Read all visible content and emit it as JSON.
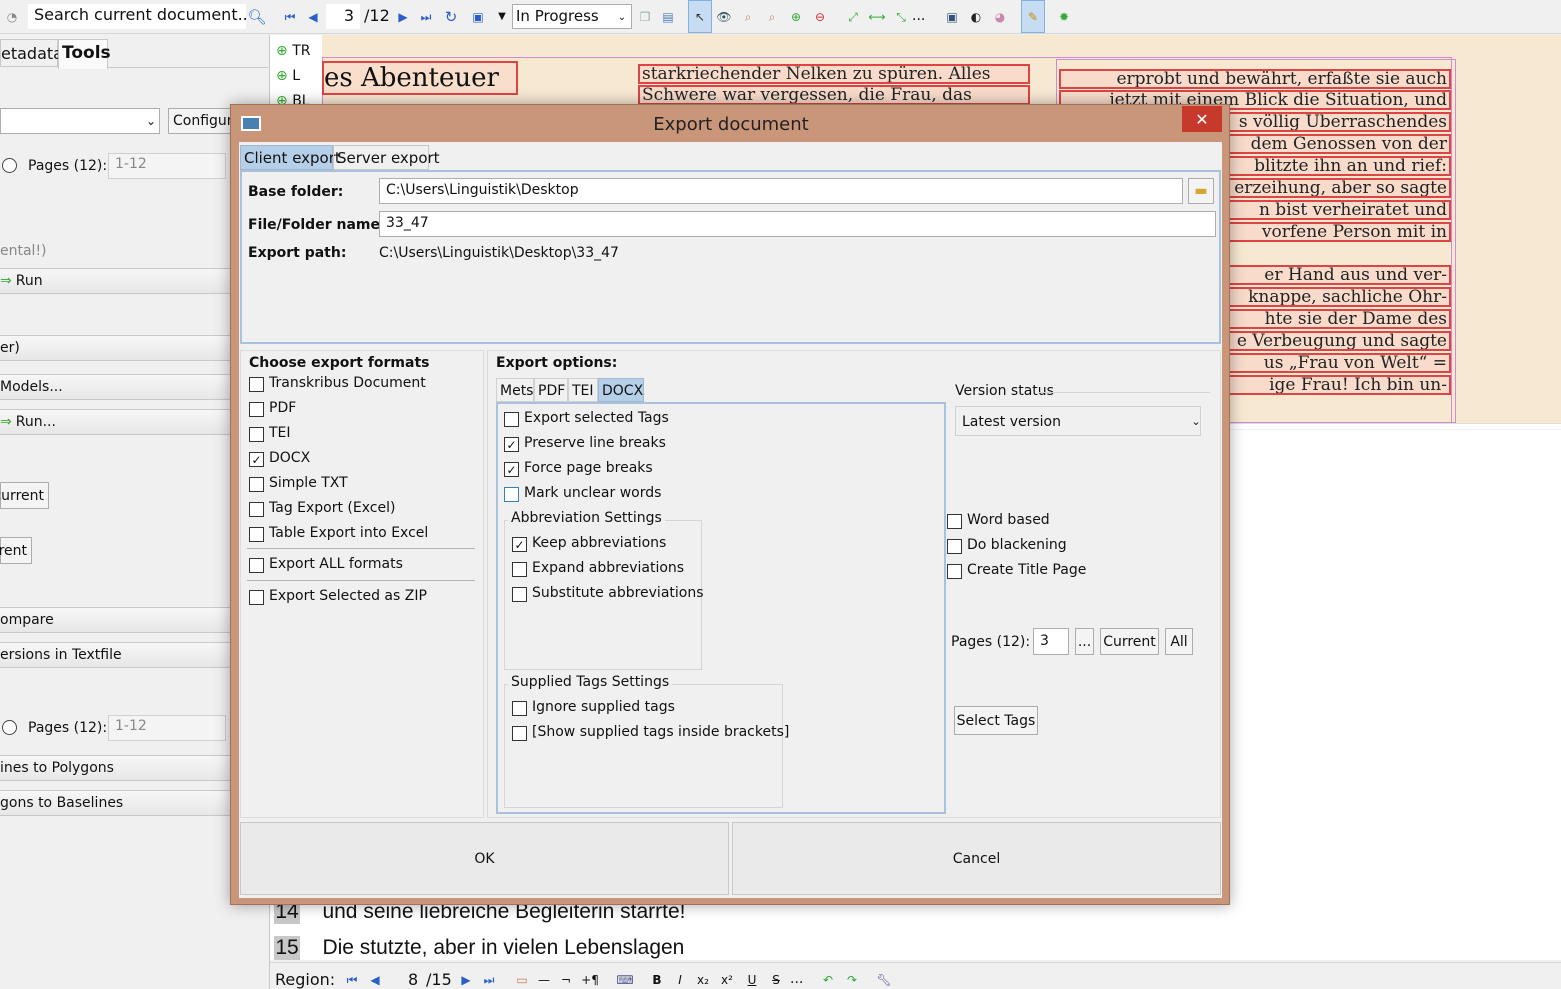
{
  "toolbar": {
    "search_placeholder": "Search current document...",
    "page_current": "3",
    "page_total": "/12",
    "status_value": "In Progress",
    "more": "..."
  },
  "left_panel": {
    "tab_metadata": "etadata",
    "tab_tools": "Tools",
    "configure_label": "Configur",
    "pages_label": "Pages (12):",
    "pages_value": "1-12",
    "experimental": "ental!)",
    "run": "Run",
    "er_label": "er)",
    "models": "Models...",
    "run2": "Run...",
    "current": "current",
    "rent": "rent",
    "compare": "ompare",
    "versions_textfile": "ersions in Textfile",
    "pages_label2": "Pages (12):",
    "pages_value2": "1-12",
    "lines_to_polygons": "ines to Polygons",
    "polygons_to_baselines": "gons to Baselines"
  },
  "layer_list": [
    "TR",
    "L",
    "BL"
  ],
  "doc_image": {
    "heading": "es Abenteuer",
    "col2": [
      "starkriechender Nelken zu spüren. Alles",
      "Schwere war vergessen, die Frau, das"
    ],
    "col3": [
      "erprobt und bewährt, erfaßte sie auch",
      "jetzt mit einem Blick die Situation, und",
      "s völlig Überraschendes",
      "dem Genossen von der",
      "blitzte ihn an und rief:",
      "erzeihung, aber so sagte",
      "n bist verheiratet und",
      "vorfene Person mit in",
      "er Hand aus und ver-",
      "knappe, sachliche Ohr-",
      "hte sie der Dame des",
      "e Verbeugung und sagte",
      "us „Frau von Welt“ =",
      "ige Frau! Ich bin un-"
    ]
  },
  "text_lines": [
    {
      "num": "14",
      "text": "und seine liebreiche Begleiterin starrte!"
    },
    {
      "num": "15",
      "text": "Die stutzte, aber in vielen Lebenslagen"
    }
  ],
  "bottom_bar": {
    "region_label": "Region:",
    "page_current": "8",
    "page_total": "/15",
    "more": "..."
  },
  "dialog": {
    "title": "Export document",
    "close": "✕",
    "tabs": [
      "Client export",
      "Server export"
    ],
    "base_folder_label": "Base folder:",
    "base_folder_value": "C:\\Users\\Linguistik\\Desktop",
    "file_name_label": "File/Folder name:",
    "file_name_value": "33_47",
    "export_path_label": "Export path:",
    "export_path_value": "C:\\Users\\Linguistik\\Desktop\\33_47",
    "formats_title": "Choose export formats",
    "formats": [
      {
        "label": "Transkribus Document",
        "checked": false
      },
      {
        "label": "PDF",
        "checked": false
      },
      {
        "label": "TEI",
        "checked": false
      },
      {
        "label": "DOCX",
        "checked": true
      },
      {
        "label": "Simple TXT",
        "checked": false
      },
      {
        "label": "Tag Export (Excel)",
        "checked": false
      },
      {
        "label": "Table Export into Excel",
        "checked": false
      }
    ],
    "export_all": "Export ALL formats",
    "export_zip": "Export Selected as ZIP",
    "options_title": "Export options:",
    "option_tabs": [
      "Mets",
      "PDF",
      "TEI",
      "DOCX"
    ],
    "options": [
      {
        "label": "Export selected Tags",
        "checked": false
      },
      {
        "label": "Preserve line breaks",
        "checked": true
      },
      {
        "label": "Force page breaks",
        "checked": true
      },
      {
        "label": "Mark unclear words",
        "checked": false
      }
    ],
    "abbrev_title": "Abbreviation Settings",
    "abbrev": [
      {
        "label": "Keep abbreviations",
        "checked": true
      },
      {
        "label": "Expand abbreviations",
        "checked": false
      },
      {
        "label": "Substitute abbreviations",
        "checked": false
      }
    ],
    "supplied_title": "Supplied Tags Settings",
    "supplied": [
      {
        "label": "Ignore supplied tags",
        "checked": false
      },
      {
        "label": "[Show supplied tags inside brackets]",
        "checked": false
      }
    ],
    "version_title": "Version status",
    "version_value": "Latest version",
    "right_opts": [
      {
        "label": "Word based",
        "checked": false
      },
      {
        "label": "Do blackening",
        "checked": false
      },
      {
        "label": "Create Title Page",
        "checked": false
      }
    ],
    "pages_label": "Pages (12):",
    "pages_value": "3",
    "dots": "...",
    "current": "Current",
    "all": "All",
    "select_tags": "Select Tags",
    "ok": "OK",
    "cancel": "Cancel"
  },
  "colors": {
    "dialog_frame": "#c9967a",
    "close_button": "#c7392b",
    "selected_tab": "#b5cfe8",
    "ocr_line_border": "#d44444",
    "doc_paper": "#f7e8d2"
  }
}
